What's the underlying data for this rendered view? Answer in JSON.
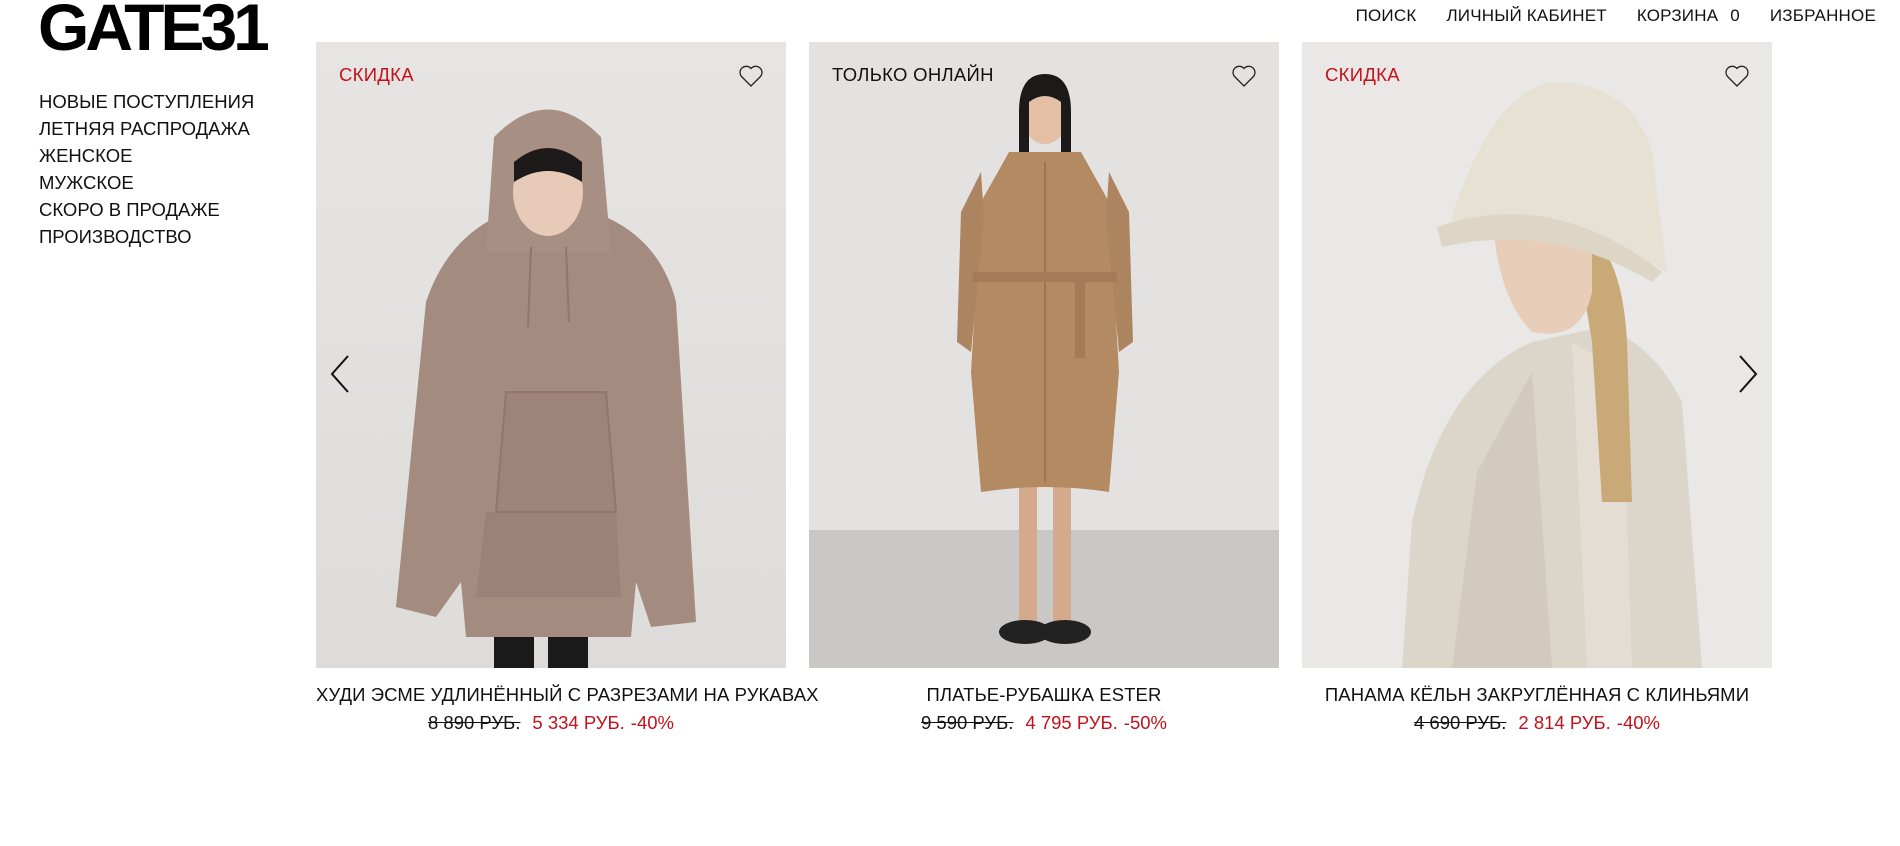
{
  "brand": {
    "logo_text": "GATE31"
  },
  "top_nav": {
    "search": "ПОИСК",
    "account": "ЛИЧНЫЙ КАБИНЕТ",
    "cart": "КОРЗИНА",
    "cart_count": "0",
    "favorites": "ИЗБРАННОЕ"
  },
  "side_nav": [
    {
      "label": "НОВЫЕ ПОСТУПЛЕНИЯ"
    },
    {
      "label": "ЛЕТНЯЯ РАСПРОДАЖА"
    },
    {
      "label": "ЖЕНСКОЕ"
    },
    {
      "label": "МУЖСКОЕ"
    },
    {
      "label": "СКОРО В ПРОДАЖЕ"
    },
    {
      "label": "ПРОИЗВОДСТВО"
    }
  ],
  "products": [
    {
      "badge": "СКИДКА",
      "name": "ХУДИ ЭСМЕ УДЛИНЁННЫЙ С РАЗРЕЗАМИ НА РУКАВАХ",
      "old_price": "8 890 РУБ.",
      "new_price": "5 334 РУБ.",
      "discount": "-40%",
      "image": "woman-in-taupe-hoodie"
    },
    {
      "badge": "ТОЛЬКО ОНЛАЙН",
      "name": "ПЛАТЬЕ-РУБАШКА ESTER",
      "old_price": "9 590 РУБ.",
      "new_price": "4 795 РУБ.",
      "discount": "-50%",
      "image": "woman-in-camel-shirt-dress"
    },
    {
      "badge": "СКИДКА",
      "name": "ПАНАМА КЁЛЬН ЗАКРУГЛЁННАЯ С КЛИНЬЯМИ",
      "old_price": "4 690 РУБ.",
      "new_price": "2 814 РУБ.",
      "discount": "-40%",
      "image": "woman-in-cream-bucket-hat"
    }
  ],
  "colors": {
    "sale_red": "#c4111a",
    "text": "#111111"
  },
  "icons": {
    "favorite": "heart-outline-icon",
    "prev": "chevron-left-icon",
    "next": "chevron-right-icon"
  }
}
